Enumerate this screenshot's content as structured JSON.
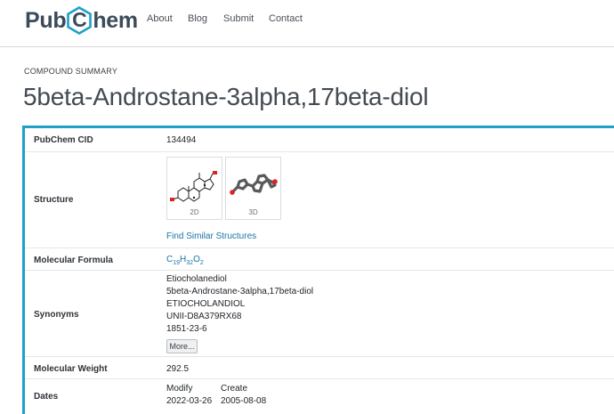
{
  "header": {
    "logo_left": "Pub",
    "logo_mid": "C",
    "logo_right": "hem",
    "nav": [
      "About",
      "Blog",
      "Submit",
      "Contact"
    ]
  },
  "page": {
    "eyebrow": "COMPOUND SUMMARY",
    "title": "5beta-Androstane-3alpha,17beta-diol"
  },
  "summary": {
    "cid": {
      "label": "PubChem CID",
      "value": "134494"
    },
    "structure": {
      "label": "Structure",
      "thumb_2d": "2D",
      "thumb_3d": "3D",
      "link": "Find Similar Structures"
    },
    "formula": {
      "label": "Molecular Formula",
      "parts": [
        "C",
        "19",
        "H",
        "32",
        "O",
        "2"
      ]
    },
    "synonyms": {
      "label": "Synonyms",
      "items": [
        "Etiocholanediol",
        "5beta-Androstane-3alpha,17beta-diol",
        "ETIOCHOLANDIOL",
        "UNII-D8A379RX68",
        "1851-23-6"
      ],
      "more": "More..."
    },
    "weight": {
      "label": "Molecular Weight",
      "value": "292.5"
    },
    "dates": {
      "label": "Dates",
      "modify_label": "Modify",
      "modify_value": "2022-03-26",
      "create_label": "Create",
      "create_value": "2005-08-08"
    }
  },
  "colors": {
    "accent": "#1ea0c8",
    "link": "#1a73a8",
    "title": "#434a52"
  }
}
